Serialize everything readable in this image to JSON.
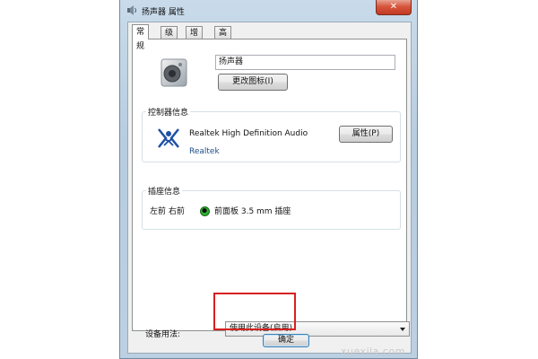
{
  "window": {
    "title": "扬声器 属性",
    "close_label": "✕"
  },
  "tabs": [
    {
      "label": "常规",
      "active": true
    },
    {
      "label": "级别",
      "active": false
    },
    {
      "label": "增强",
      "active": false
    },
    {
      "label": "高级",
      "active": false
    }
  ],
  "general": {
    "name_value": "扬声器",
    "change_icon_label": "更改图标(I)"
  },
  "controller": {
    "group_label": "控制器信息",
    "device_name": "Realtek High Definition Audio",
    "vendor": "Realtek",
    "properties_label": "属性(P)"
  },
  "jack": {
    "group_label": "插座信息",
    "position": "左前 右前",
    "description": "前面板 3.5 mm 插座",
    "jack_color": "#2fae2f"
  },
  "usage": {
    "label": "设备用法:",
    "selected": "使用此设备(启用)"
  },
  "footer": {
    "ok_label": "确定"
  },
  "watermark": "xuexila.com",
  "colors": {
    "highlight": "#d82020",
    "accent": "#1c4e8a"
  }
}
